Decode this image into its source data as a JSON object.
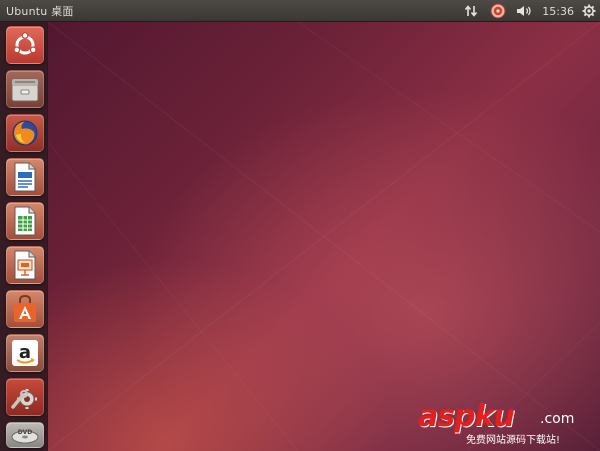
{
  "panel": {
    "title": "Ubuntu 桌面",
    "clock": "15:36",
    "indicators": [
      "network-icon",
      "messaging-icon",
      "volume-icon",
      "system-gear-icon"
    ]
  },
  "launcher": {
    "items": [
      {
        "name": "dash-home",
        "icon": "ubuntu-logo-icon",
        "color": "#dd4814"
      },
      {
        "name": "files",
        "icon": "file-cabinet-icon",
        "color": "#8a8680"
      },
      {
        "name": "firefox",
        "icon": "firefox-icon",
        "color": "#e66000"
      },
      {
        "name": "libreoffice-writer",
        "icon": "writer-doc-icon",
        "color": "#2a6fb5"
      },
      {
        "name": "libreoffice-calc",
        "icon": "calc-sheet-icon",
        "color": "#43a047"
      },
      {
        "name": "libreoffice-impress",
        "icon": "impress-slide-icon",
        "color": "#d8642a"
      },
      {
        "name": "software-center",
        "icon": "shopping-bag-icon",
        "color": "#e9642a"
      },
      {
        "name": "amazon",
        "icon": "amazon-icon",
        "color": "#ffffff"
      },
      {
        "name": "system-settings",
        "icon": "settings-wrench-icon",
        "color": "#b23b2e"
      },
      {
        "name": "dvd",
        "icon": "dvd-icon",
        "color": "#9a9a9a"
      }
    ]
  },
  "watermark": {
    "brand": "aspku",
    "suffix": ".com",
    "slogan": "免费网站源码下载站!"
  }
}
